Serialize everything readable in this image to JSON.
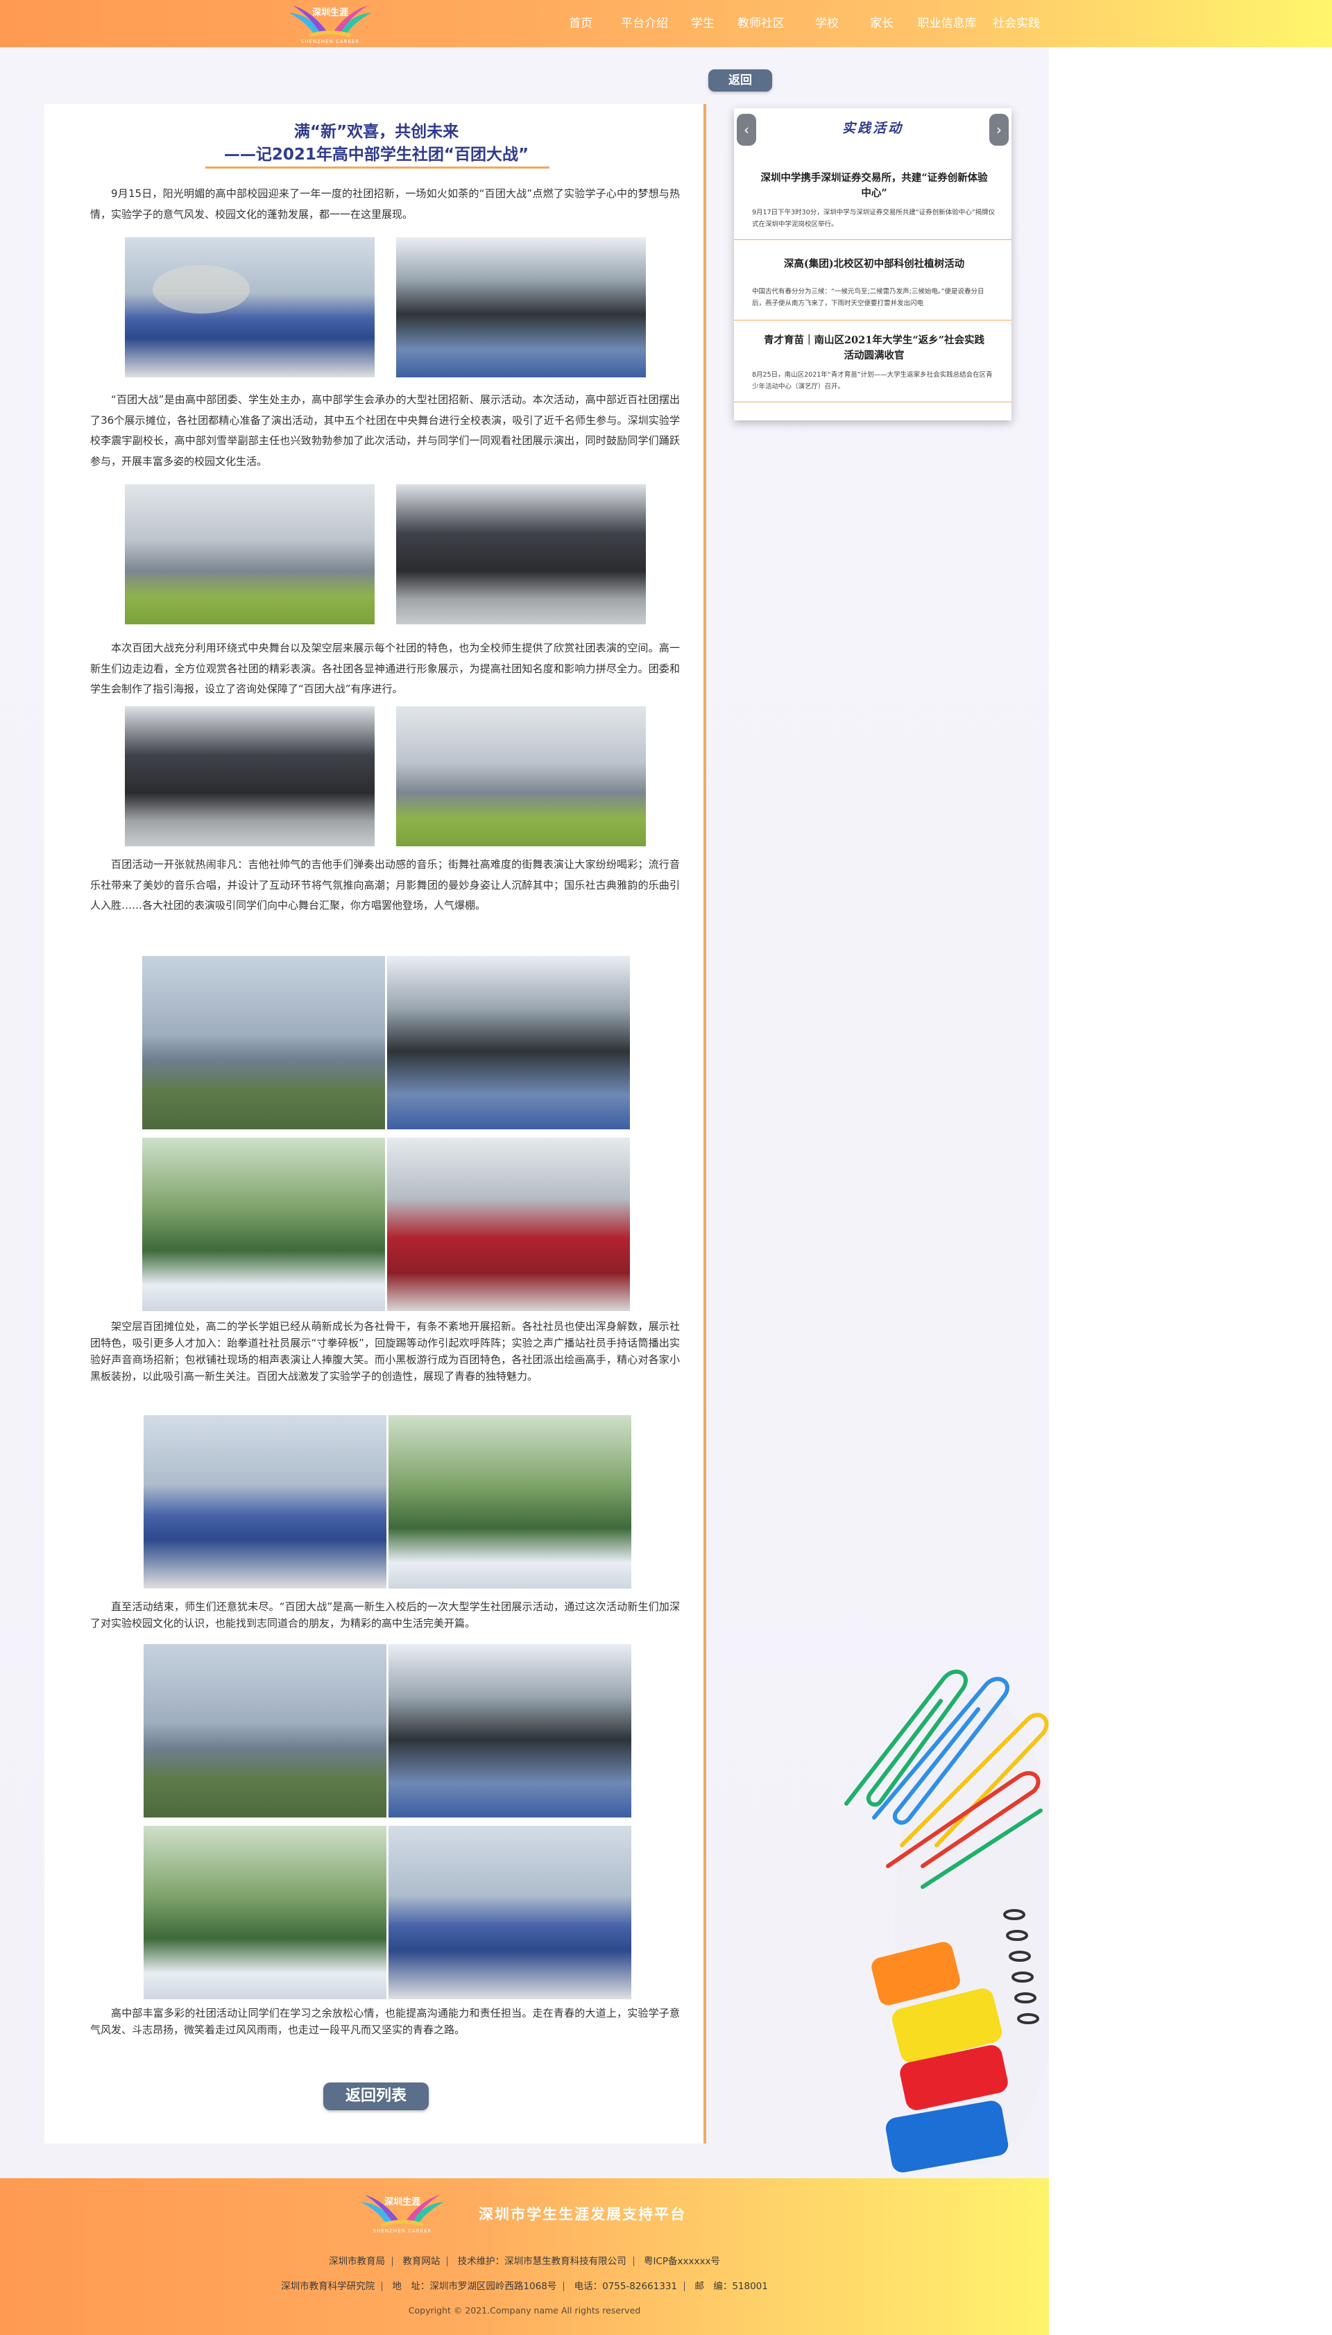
{
  "header": {
    "logo_text": "深圳生涯",
    "logo_subtext": "SHENZHEN CAREER",
    "nav": [
      "首页",
      "平台介绍",
      "学生",
      "教师社区",
      "学校",
      "家长",
      "职业信息库",
      "社会实践"
    ]
  },
  "back_top_label": "返回",
  "article": {
    "title_line1": "满“新”欢喜，共创未来",
    "title_line2": "——记2021年高中部学生社团“百团大战”",
    "paragraphs": [
      "9月15日，阳光明媚的高中部校园迎来了一年一度的社团招新，一场如火如荼的“百团大战”点燃了实验学子心中的梦想与热情，实验学子的意气风发、校园文化的蓬勃发展，都一一在这里展现。",
      "“百团大战”是由高中部团委、学生处主办，高中部学生会承办的大型社团招新、展示活动。本次活动，高中部近百社团摆出了36个展示摊位，各社团都精心准备了演出活动，其中五个社团在中央舞台进行全校表演，吸引了近千名师生参与。深圳实验学校李震宇副校长，高中部刘雪举副部主任也兴致勃勃参加了此次活动，并与同学们一同观看社团展示演出，同时鼓励同学们踊跃参与，开展丰富多姿的校园文化生活。",
      "本次百团大战充分利用环绕式中央舞台以及架空层来展示每个社团的特色，也为全校师生提供了欣赏社团表演的空间。高一新生们边走边看，全方位观赏各社团的精彩表演。各社团各显神通进行形象展示，为提高社团知名度和影响力拼尽全力。团委和学生会制作了指引海报，设立了咨询处保障了“百团大战”有序进行。",
      "百团活动一开张就热闹非凡：吉他社帅气的吉他手们弹奏出动感的音乐；街舞社高难度的街舞表演让大家纷纷喝彩；流行音乐社带来了美妙的音乐合唱，并设计了互动环节将气氛推向高潮；月影舞团的曼妙身姿让人沉醉其中；国乐社古典雅韵的乐曲引人入胜……各大社团的表演吸引同学们向中心舞台汇聚，你方唱罢他登场，人气爆棚。",
      "架空层百团摊位处，高二的学长学姐已经从萌新成长为各社骨干，有条不紊地开展招新。各社社员也使出浑身解数，展示社团特色，吸引更多人才加入：跆拳道社社员展示“寸拳碎板”，回旋踢等动作引起欢呼阵阵；实验之声广播站社员手持话筒播出实验好声音商场招新；包袱铺社现场的相声表演让人捧腹大笑。而小黑板游行成为百团特色，各社团派出绘画高手，精心对各家小黑板装扮，以此吸引高一新生关注。百团大战激发了实验学子的创造性，展现了青春的独特魅力。",
      "直至活动结束，师生们还意犹未尽。“百团大战”是高一新生入校后的一次大型学生社团展示活动，通过这次活动新生们加深了对实验校园文化的认识，也能找到志同道合的朋友，为精彩的高中生活完美开篇。",
      "高中部丰富多彩的社团活动让同学们在学习之余放松心情，也能提高沟通能力和责任担当。走在青春的大道上，实验学子意气风发、斗志昂扬，微笑着走过风风雨雨，也走过一段平凡而又坚实的青春之路。"
    ]
  },
  "sidebar": {
    "title": "实践活动",
    "prev_arrow": "‹",
    "next_arrow": "›",
    "items": [
      {
        "title": "深圳中学携手深圳证券交易所，共建“证券创新体验中心”",
        "desc": "9月17日下午3时30分，深圳中学与深圳证券交易所共建“证券创新体验中心”揭牌仪式在深圳中学泥岗校区举行。"
      },
      {
        "title": "深高(集团)北校区初中部科创社植树活动",
        "desc": "中国古代有春分分为三候：“一候元鸟至;二候雷乃发声;三候始电。”便是说春分日后，燕子便从南方飞来了，下雨时天空便要打雷并发出闪电"
      },
      {
        "title": "青才育苗｜南山区2021年大学生“返乡”社会实践活动圆满收官",
        "desc": "8月25日，南山区2021年“青才育苗”计划——大学生返家乡社会实践总结会在区青少年活动中心（演艺厅）召开。"
      }
    ]
  },
  "back_bottom_label": "返回列表",
  "footer": {
    "platform_name": "深圳市学生生涯发展支持平台",
    "row1": [
      "深圳市教育局",
      "教育网站",
      "技术维护：深圳市慧生教育科技有限公司",
      "粤ICP备xxxxxx号"
    ],
    "row2": [
      "深圳市教育科学研究院",
      "地　址：深圳市罗湖区园岭西路1068号",
      "电话：0755-82661331",
      "邮　编：518001"
    ],
    "copyright": "Copyright © 2021.Company name All rights reserved"
  },
  "colors": {
    "accent_orange": "#f4a860",
    "title_navy": "#2f3b8d",
    "button_slate": "#5b6e8a"
  }
}
